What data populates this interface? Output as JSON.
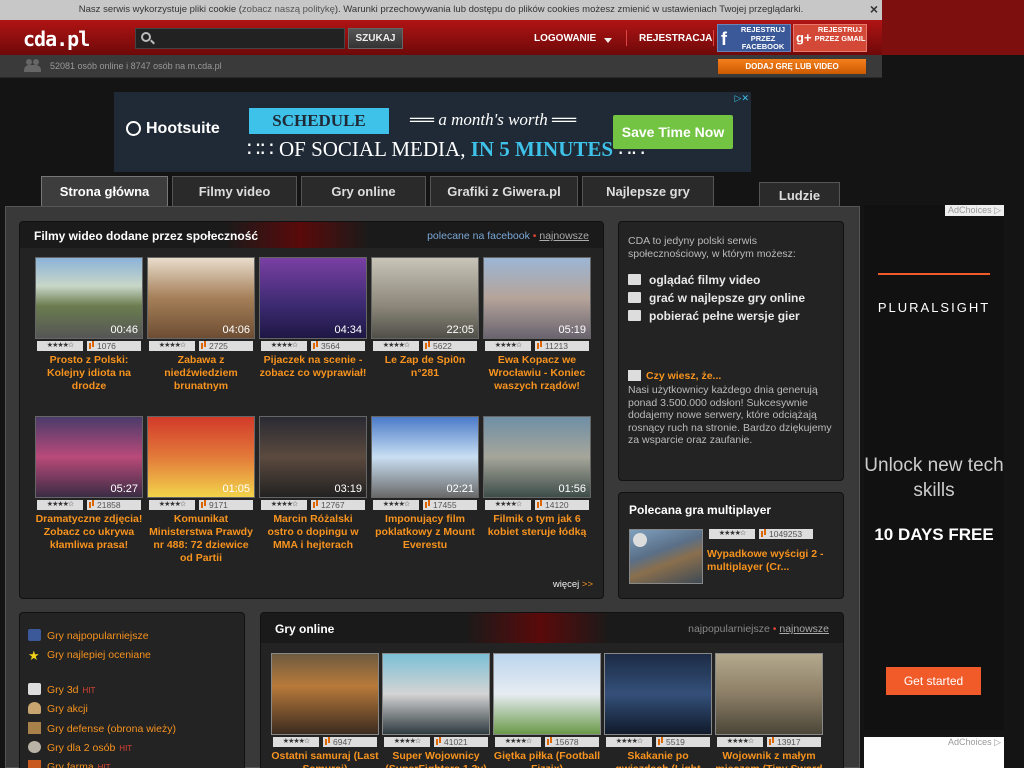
{
  "cookie": {
    "text_before": "Nasz serwis wykorzystuje pliki cookie (",
    "link": "zobacz naszą politykę",
    "text_after": "). Warunki przechowywania lub dostępu do plików cookies możesz zmienić w ustawieniach Twojej przeglądarki.",
    "close": "×"
  },
  "header": {
    "logo": "cda.pl",
    "search_placeholder": "",
    "search_button": "SZUKAJ",
    "login": "LOGOWANIE",
    "register": "REJESTRACJA",
    "fb_button": "REJESTRUJ PRZEZ FACEBOOK",
    "fb_icon": "f",
    "gplus_button": "REJESTRUJ PRZEZ GMAIL",
    "gplus_icon": "g+"
  },
  "subheader": {
    "online": "52081 osób online i 8747 osób na m.cda.pl",
    "add_game": "DODAJ GRĘ LUB VIDEO"
  },
  "ad_top": {
    "brand": "Hootsuite",
    "banner": "SCHEDULE",
    "line1": "══ a month's worth ══",
    "line2_a": "∷∷ OF SOCIAL MEDIA,",
    "line2_b": "IN 5 MINUTES",
    "line2_c": "∷∷",
    "cta": "Save Time Now",
    "close": "▷✕"
  },
  "tabs": [
    "Strona główna",
    "Filmy video",
    "Gry online",
    "Grafiki z Giwera.pl",
    "Najlepsze gry",
    "Ludzie"
  ],
  "videos_panel": {
    "title": "Filmy wideo dodane przez społeczność",
    "link1": "polecane na facebook",
    "sep": "•",
    "link2": "najnowsze",
    "more": "więcej",
    "more_arrow": ">>",
    "items": [
      {
        "dur": "00:46",
        "stars": "★★★★☆",
        "views": "1076",
        "title": "Prosto z Polski: Kolejny idiota na drodze"
      },
      {
        "dur": "04:06",
        "stars": "★★★★☆",
        "views": "2725",
        "title": "Zabawa z niedźwiedziem brunatnym"
      },
      {
        "dur": "04:34",
        "stars": "★★★★☆",
        "views": "3564",
        "title": "Pijaczek na scenie - zobacz co wyprawiał!"
      },
      {
        "dur": "22:05",
        "stars": "★★★★☆",
        "views": "5622",
        "title": "Le Zap de Spi0n n°281"
      },
      {
        "dur": "05:19",
        "stars": "★★★★☆",
        "views": "11213",
        "title": "Ewa Kopacz we Wrocławiu - Koniec waszych rządów!"
      },
      {
        "dur": "05:27",
        "stars": "★★★★☆",
        "views": "21858",
        "title": "Dramatyczne zdjęcia! Zobacz co ukrywa kłamliwa prasa!"
      },
      {
        "dur": "01:05",
        "stars": "★★★★☆",
        "views": "9171",
        "title": "Komunikat Ministerstwa Prawdy nr 488: 72 dziewice od Partii"
      },
      {
        "dur": "03:19",
        "stars": "★★★★☆",
        "views": "12767",
        "title": "Marcin Różalski ostro o dopingu w MMA i hejterach"
      },
      {
        "dur": "02:21",
        "stars": "★★★★☆",
        "views": "17455",
        "title": "Imponujący film poklatkowy z Mount Everestu"
      },
      {
        "dur": "01:56",
        "stars": "★★★★☆",
        "views": "14120",
        "title": "Filmik o tym jak 6 kobiet steruje łódką"
      }
    ]
  },
  "info": {
    "intro": "CDA to jedyny polski serwis społecznościowy, w którym możesz:",
    "features": [
      "oglądać filmy video",
      "grać w najlepsze gry online",
      "pobierać pełne wersje gier"
    ],
    "fact_title": "Czy wiesz, że...",
    "fact_text": "Nasi użytkownicy każdego dnia generują ponad 3.500.000 odsłon! Sukcesywnie dodajemy nowe serwery, które odciążają rosnący ruch na stronie. Bardzo dziękujemy za wsparcie oraz zaufanie."
  },
  "multiplayer": {
    "title": "Polecana gra multiplayer",
    "stars": "★★★★☆",
    "views": "1049253",
    "game": "Wypadkowe wyścigi 2 - multiplayer (Cr..."
  },
  "sidebar": {
    "items": [
      {
        "label": "Gry najpopularniejsze",
        "hit": ""
      },
      {
        "label": "Gry najlepiej oceniane",
        "hit": ""
      },
      {
        "label": "Gry 3d",
        "hit": "HIT"
      },
      {
        "label": "Gry akcji",
        "hit": ""
      },
      {
        "label": "Gry defense (obrona wieży)",
        "hit": ""
      },
      {
        "label": "Gry dla 2 osób",
        "hit": "HIT"
      },
      {
        "label": "Gry farma",
        "hit": "HIT"
      }
    ]
  },
  "games_panel": {
    "title": "Gry online",
    "link1": "najpopularniejsze",
    "sep": "•",
    "link2": "najnowsze",
    "items": [
      {
        "stars": "★★★★☆",
        "views": "6947",
        "title": "Ostatni samuraj (Last Samurai)"
      },
      {
        "stars": "★★★★☆",
        "views": "41021",
        "title": "Super Wojownicy (SuperFighters 1.3v)"
      },
      {
        "stars": "★★★★☆",
        "views": "15678",
        "title": "Giętka piłka (Football Fizzix)"
      },
      {
        "stars": "★★★★☆",
        "views": "5519",
        "title": "Skakanie po gwiazdach (Light"
      },
      {
        "stars": "★★★★☆",
        "views": "13917",
        "title": "Wojownik z małym mieczem (Tiny Sword"
      }
    ]
  },
  "ad_right": {
    "choices": "AdChoices ▷",
    "brand": "PLURALSIGHT",
    "unlock": "Unlock new tech skills",
    "free": "10 DAYS FREE",
    "cta": "Get started"
  },
  "ad_right2": {
    "choices": "AdChoices ▷"
  }
}
